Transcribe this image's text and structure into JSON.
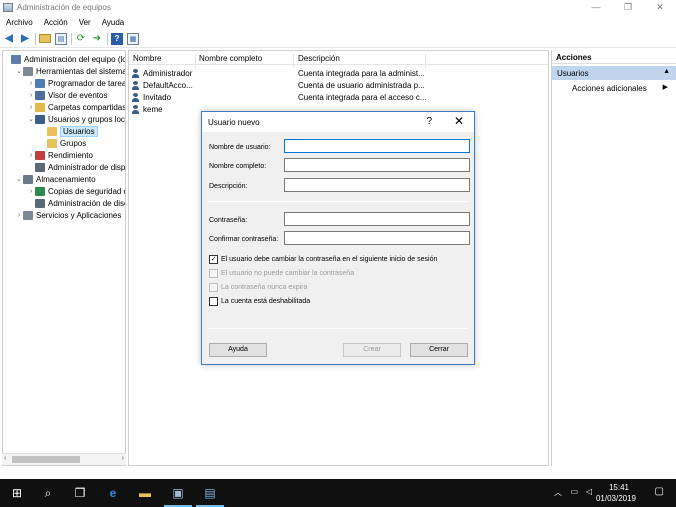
{
  "window": {
    "title": "Administración de equipos",
    "minimize": "—",
    "maximize": "❐",
    "close": "✕"
  },
  "menu": [
    "Archivo",
    "Acción",
    "Ver",
    "Ayuda"
  ],
  "tree": {
    "items": [
      {
        "label": "Administración del equipo (loc",
        "depth": 0,
        "expander": "",
        "icon": "computer-icon",
        "color": "#5a7fa8"
      },
      {
        "label": "Herramientas del sistema",
        "depth": 1,
        "expander": "⌄",
        "icon": "tools-icon",
        "color": "#7a8a9a"
      },
      {
        "label": "Programador de tareas",
        "depth": 2,
        "expander": "›",
        "icon": "clock-icon",
        "color": "#4c7db5"
      },
      {
        "label": "Visor de eventos",
        "depth": 2,
        "expander": "›",
        "icon": "event-viewer-icon",
        "color": "#4c6e9c"
      },
      {
        "label": "Carpetas compartidas",
        "depth": 2,
        "expander": "›",
        "icon": "shared-folder-icon",
        "color": "#e5b94a"
      },
      {
        "label": "Usuarios y grupos locale",
        "depth": 2,
        "expander": "⌄",
        "icon": "users-icon",
        "color": "#3a5d8a"
      },
      {
        "label": "Usuarios",
        "depth": 3,
        "expander": "",
        "icon": "folder-icon",
        "color": "#e8c15a",
        "selected": true
      },
      {
        "label": "Grupos",
        "depth": 3,
        "expander": "",
        "icon": "folder-icon",
        "color": "#e8c15a"
      },
      {
        "label": "Rendimiento",
        "depth": 2,
        "expander": "›",
        "icon": "performance-icon",
        "color": "#c04040"
      },
      {
        "label": "Administrador de dispo",
        "depth": 2,
        "expander": "",
        "icon": "device-manager-icon",
        "color": "#5a6a7a"
      },
      {
        "label": "Almacenamiento",
        "depth": 1,
        "expander": "⌄",
        "icon": "storage-icon",
        "color": "#6a7a8a"
      },
      {
        "label": "Copias de seguridad de",
        "depth": 2,
        "expander": "›",
        "icon": "backup-icon",
        "color": "#2f8a4f"
      },
      {
        "label": "Administración de disco",
        "depth": 2,
        "expander": "",
        "icon": "disk-icon",
        "color": "#5a6a7a"
      },
      {
        "label": "Servicios y Aplicaciones",
        "depth": 1,
        "expander": "›",
        "icon": "services-icon",
        "color": "#7a8a9a"
      }
    ]
  },
  "list": {
    "columns": [
      "Nombre",
      "Nombre completo",
      "Descripción"
    ],
    "rows": [
      {
        "name": "Administrador",
        "fullname": "",
        "description": "Cuenta integrada para la administ..."
      },
      {
        "name": "DefaultAcco...",
        "fullname": "",
        "description": "Cuenta de usuario administrada p..."
      },
      {
        "name": "Invitado",
        "fullname": "",
        "description": "Cuenta integrada para el acceso c..."
      },
      {
        "name": "keme",
        "fullname": "",
        "description": ""
      }
    ]
  },
  "actions": {
    "title": "Acciones",
    "section": "Usuarios",
    "section_caret": "▲",
    "more": "Acciones adicionales",
    "more_caret": "▶"
  },
  "dialog": {
    "title": "Usuario nuevo",
    "help": "?",
    "close": "✕",
    "fields": {
      "username": {
        "label": "Nombre de usuario:",
        "value": ""
      },
      "fullname": {
        "label": "Nombre completo:",
        "value": ""
      },
      "description": {
        "label": "Descripción:",
        "value": ""
      },
      "password": {
        "label": "Contraseña:",
        "value": ""
      },
      "confirm": {
        "label": "Confirmar contraseña:",
        "value": ""
      }
    },
    "checks": [
      {
        "label": "El usuario debe cambiar la contraseña en el siguiente inicio de sesión",
        "checked": true,
        "enabled": true
      },
      {
        "label": "El usuario no puede cambiar la contraseña",
        "checked": false,
        "enabled": false
      },
      {
        "label": "La contraseña nunca expira",
        "checked": false,
        "enabled": false
      },
      {
        "label": "La cuenta está deshabilitada",
        "checked": false,
        "enabled": true
      }
    ],
    "buttons": {
      "help": "Ayuda",
      "create": "Crear",
      "close": "Cerrar"
    }
  },
  "taskbar": {
    "time": "15:41",
    "date": "01/03/2019"
  },
  "colors": {
    "accent": "#0078d7",
    "selection": "#cce8ff",
    "actions_section": "#bfd5ee",
    "taskbar": "#101010"
  }
}
